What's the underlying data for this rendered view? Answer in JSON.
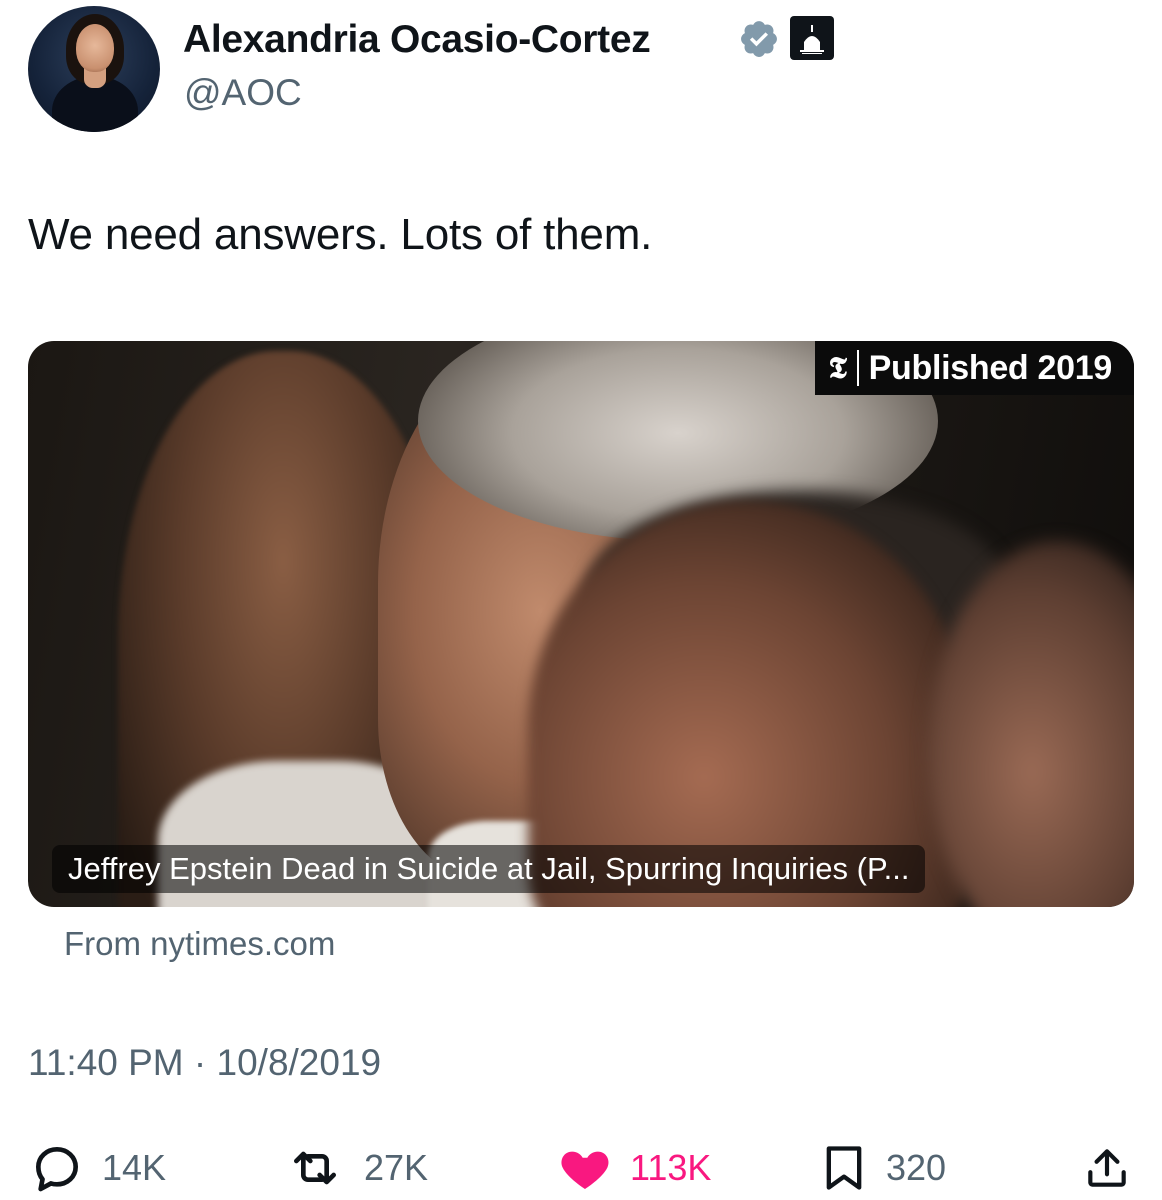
{
  "author": {
    "name": "Alexandria Ocasio-Cortez",
    "handle": "@AOC",
    "verified_icon": "verified-badge-icon",
    "affiliation_icon": "capitol-building-icon"
  },
  "tweet": {
    "text": "We need answers. Lots of them.",
    "timestamp": "11:40 PM · 10/8/2019"
  },
  "link_card": {
    "badge_logo": "𝕿",
    "badge_text": "Published 2019",
    "headline": "Jeffrey Epstein Dead in Suicide at Jail, Spurring Inquiries (P...",
    "source": "From nytimes.com"
  },
  "actions": {
    "replies": "14K",
    "retweets": "27K",
    "likes": "113K",
    "bookmarks": "320"
  },
  "colors": {
    "secondary_text": "#536471",
    "like": "#f91880",
    "verified": "#829aab"
  }
}
